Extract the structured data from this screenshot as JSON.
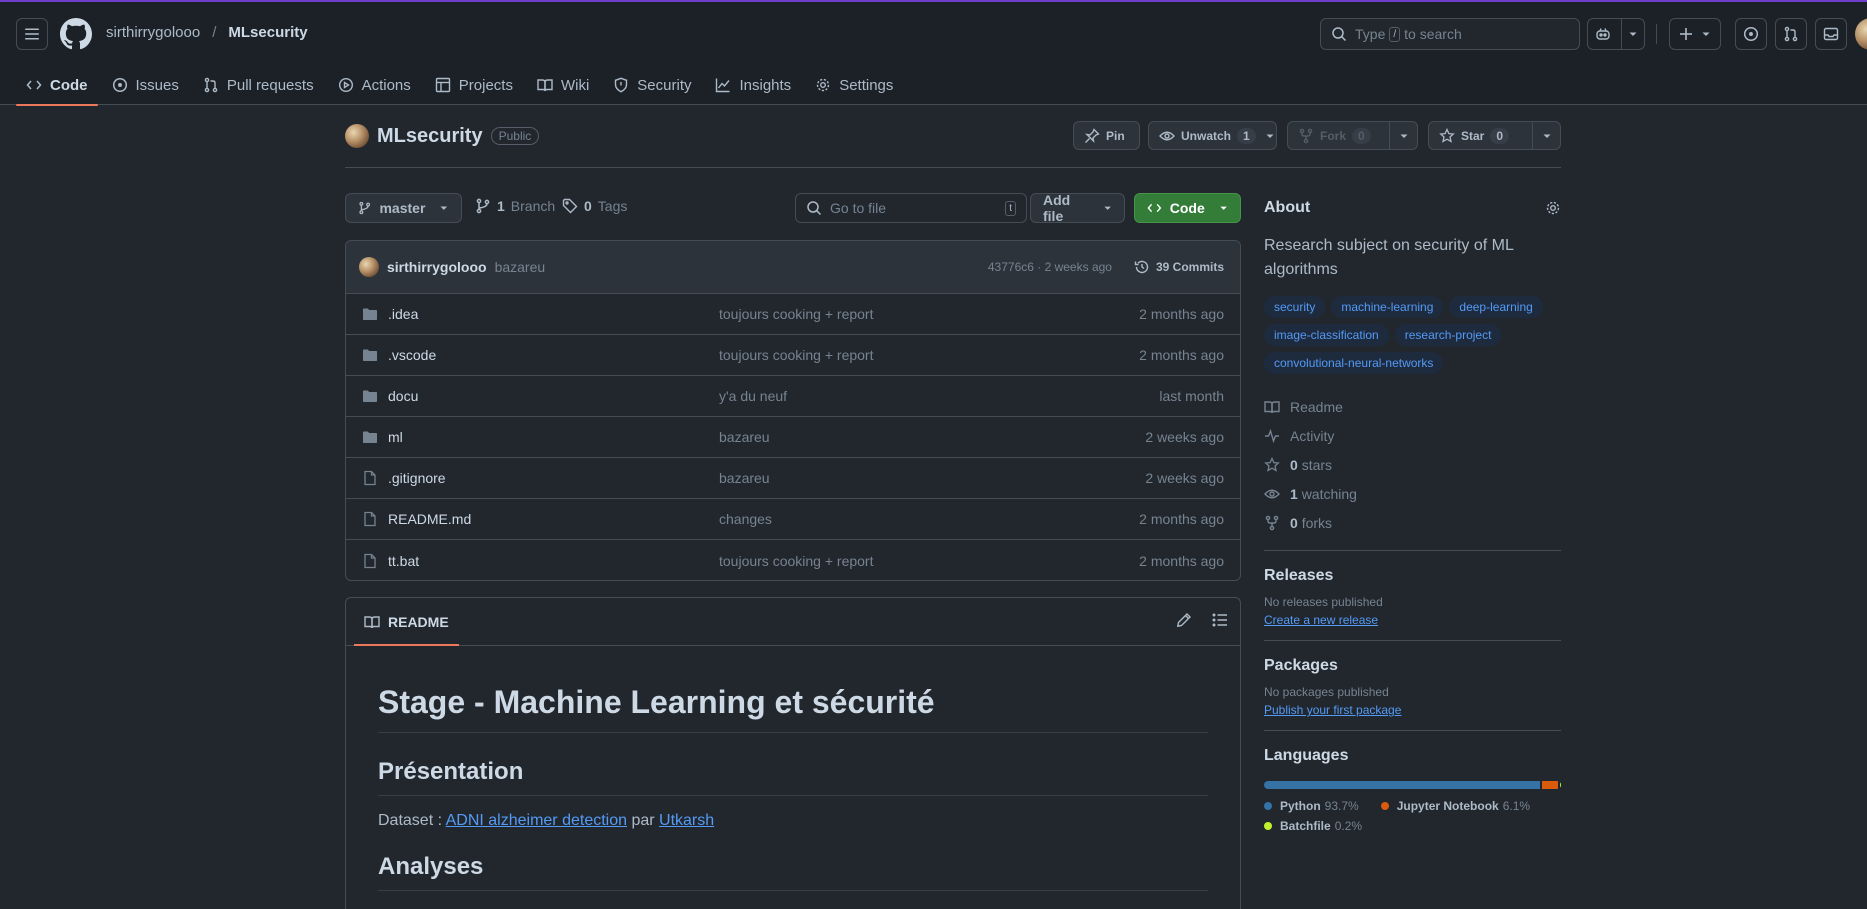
{
  "header": {
    "owner": "sirthirrygolooo",
    "slash": "/",
    "repo": "MLsecurity",
    "search_prefix": "Type",
    "search_key": "/",
    "search_suffix": "to search"
  },
  "nav": {
    "code": "Code",
    "issues": "Issues",
    "pull_requests": "Pull requests",
    "actions": "Actions",
    "projects": "Projects",
    "wiki": "Wiki",
    "security": "Security",
    "insights": "Insights",
    "settings": "Settings"
  },
  "repo_header": {
    "name": "MLsecurity",
    "visibility": "Public",
    "pin": "Pin",
    "unwatch": "Unwatch",
    "watch_count": "1",
    "fork": "Fork",
    "fork_count": "0",
    "star": "Star",
    "star_count": "0"
  },
  "browser": {
    "branch": "master",
    "branch_count": "1",
    "branch_label": "Branch",
    "tag_count": "0",
    "tag_label": "Tags",
    "go_to_file": "Go to file",
    "go_to_file_key": "t",
    "add_file": "Add file",
    "code": "Code"
  },
  "latest_commit": {
    "author": "sirthirrygolooo",
    "message": "bazareu",
    "meta": "43776c6 · 2 weeks ago",
    "commits": "39 Commits"
  },
  "files": [
    {
      "name": ".idea",
      "type": "folder",
      "message": "toujours cooking + report",
      "date": "2 months ago"
    },
    {
      "name": ".vscode",
      "type": "folder",
      "message": "toujours cooking + report",
      "date": "2 months ago"
    },
    {
      "name": "docu",
      "type": "folder",
      "message": "y'a du neuf",
      "date": "last month"
    },
    {
      "name": "ml",
      "type": "folder",
      "message": "bazareu",
      "date": "2 weeks ago"
    },
    {
      "name": ".gitignore",
      "type": "file",
      "message": "bazareu",
      "date": "2 weeks ago"
    },
    {
      "name": "README.md",
      "type": "file",
      "message": "changes",
      "date": "2 months ago"
    },
    {
      "name": "tt.bat",
      "type": "file",
      "message": "toujours cooking + report",
      "date": "2 months ago"
    }
  ],
  "readme": {
    "tab": "README",
    "h1": "Stage - Machine Learning et sécurité",
    "h2_presentation": "Présentation",
    "dataset_prefix": "Dataset : ",
    "dataset_link": "ADNI alzheimer detection",
    "dataset_mid": " par ",
    "dataset_author": "Utkarsh",
    "h2_analyses": "Analyses"
  },
  "about": {
    "title": "About",
    "description": "Research subject on security of ML algorithms",
    "topics": [
      "security",
      "machine-learning",
      "deep-learning",
      "image-classification",
      "research-project",
      "convolutional-neural-networks"
    ],
    "readme": "Readme",
    "activity": "Activity",
    "stars_count": "0",
    "stars_label": "stars",
    "watching_count": "1",
    "watching_label": "watching",
    "forks_count": "0",
    "forks_label": "forks"
  },
  "releases": {
    "title": "Releases",
    "empty": "No releases published",
    "link": "Create a new release"
  },
  "packages": {
    "title": "Packages",
    "empty": "No packages published",
    "link": "Publish your first package"
  },
  "languages": {
    "title": "Languages",
    "items": [
      {
        "name": "Python",
        "percent": "93.7%",
        "value": 93.7,
        "color": "#3572A5"
      },
      {
        "name": "Jupyter Notebook",
        "percent": "6.1%",
        "value": 6.1,
        "color": "#DA5B0B"
      },
      {
        "name": "Batchfile",
        "percent": "0.2%",
        "value": 0.2,
        "color": "#C1F12E"
      }
    ]
  }
}
